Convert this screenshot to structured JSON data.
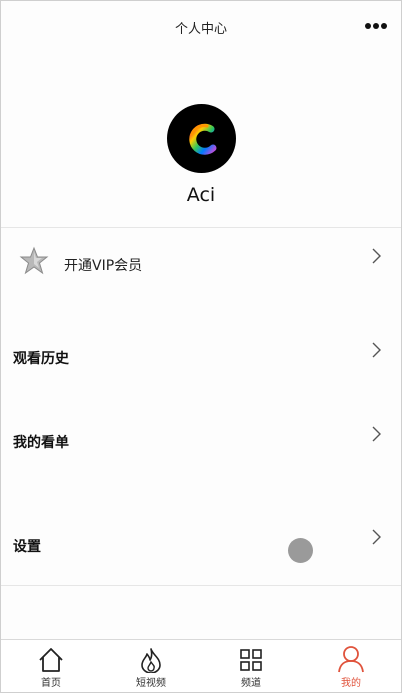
{
  "header": {
    "title": "个人中心",
    "more_icon": "more-dots-icon"
  },
  "profile": {
    "avatar_icon": "rainbow-c-logo",
    "username": "Aci"
  },
  "vip": {
    "icon": "vip-star-icon",
    "label": "开通VIP会员"
  },
  "menu": [
    {
      "label": "观看历史",
      "icon": "chevron-right-icon"
    },
    {
      "label": "我的看单",
      "icon": "chevron-right-icon"
    },
    {
      "label": "设置",
      "icon": "chevron-right-icon"
    }
  ],
  "tabbar": {
    "active_color": "#e0533c",
    "items": [
      {
        "label": "首页",
        "icon": "home-icon"
      },
      {
        "label": "短视频",
        "icon": "flame-icon"
      },
      {
        "label": "频道",
        "icon": "grid-icon"
      },
      {
        "label": "我的",
        "icon": "user-icon",
        "active": true
      }
    ]
  }
}
